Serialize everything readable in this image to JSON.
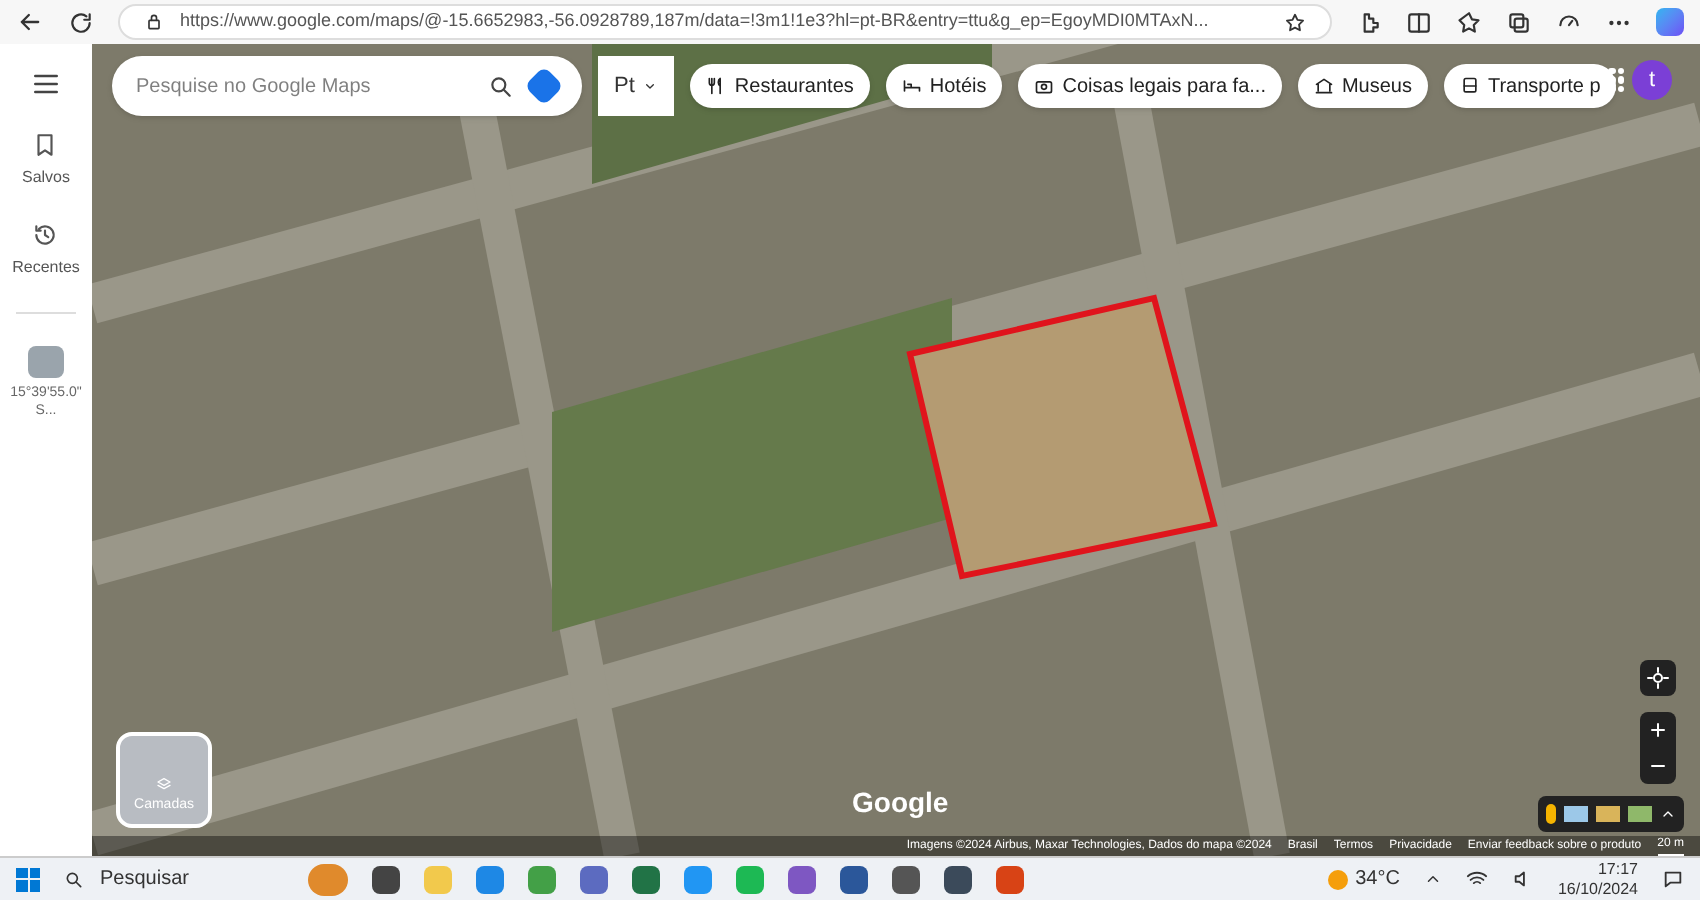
{
  "browser": {
    "url": "https://www.google.com/maps/@-15.6652983,-56.0928789,187m/data=!3m1!1e3?hl=pt-BR&entry=ttu&g_ep=EgoyMDI0MTAxN..."
  },
  "maps": {
    "search": {
      "placeholder": "Pesquise no Google Maps"
    },
    "elevation_chip": "Pt",
    "chips": [
      {
        "label": "Restaurantes",
        "kind": "fork"
      },
      {
        "label": "Hotéis",
        "kind": "bed"
      },
      {
        "label": "Coisas legais para fa...",
        "kind": "camera"
      },
      {
        "label": "Museus",
        "kind": "museum"
      },
      {
        "label": "Transporte p",
        "kind": "bus"
      }
    ],
    "avatar": "t",
    "sidebar": [
      {
        "label": "Salvos",
        "kind": "bookmark"
      },
      {
        "label": "Recentes",
        "kind": "history"
      }
    ],
    "recent_place": {
      "label": "15°39'55.0\" S..."
    },
    "layers_button": "Camadas",
    "logo": "Google",
    "attribution": "Imagens ©2024 Airbus, Maxar Technologies, Dados do mapa ©2024",
    "footer_links": [
      "Brasil",
      "Termos",
      "Privacidade",
      "Enviar feedback sobre o produto"
    ],
    "scale": "20 m"
  },
  "taskbar": {
    "search": "Pesquisar",
    "apps": [
      {
        "kind": "task-view"
      },
      {
        "kind": "folder"
      },
      {
        "kind": "browser"
      },
      {
        "kind": "phone"
      },
      {
        "kind": "photos"
      },
      {
        "kind": "excel"
      },
      {
        "kind": "store"
      },
      {
        "kind": "spotify"
      },
      {
        "kind": "notes"
      },
      {
        "kind": "word"
      },
      {
        "kind": "circle"
      },
      {
        "kind": "calculator"
      },
      {
        "kind": "paint"
      }
    ],
    "weather": "34°C",
    "time": "17:17",
    "date": "16/10/2024"
  }
}
